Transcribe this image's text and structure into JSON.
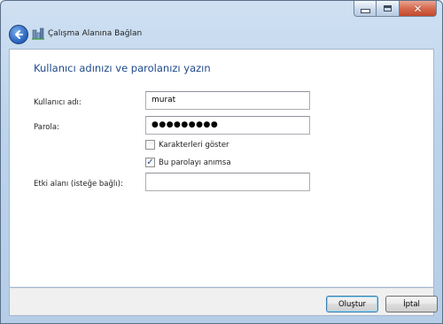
{
  "window": {
    "title": "Çalışma Alanına Bağlan",
    "controls": {
      "minimize": "minimize-icon",
      "maximize": "maximize-icon",
      "close": "close-icon"
    }
  },
  "form": {
    "heading": "Kullanıcı adınızı ve parolanızı yazın",
    "username_label": "Kullanıcı adı:",
    "username_value": "murat",
    "password_label": "Parola:",
    "password_value": "●●●●●●●●●",
    "show_chars_label": "Karakterleri göster",
    "show_chars_checked": false,
    "remember_label": "Bu parolayı anımsa",
    "remember_checked": true,
    "domain_label": "Etki alanı (isteğe bağlı):",
    "domain_value": ""
  },
  "footer": {
    "create_label": "Oluştur",
    "cancel_label": "İptal"
  },
  "colors": {
    "heading": "#1f4a8a",
    "frame": "#bcd3ec",
    "close_button": "#c2482a"
  }
}
